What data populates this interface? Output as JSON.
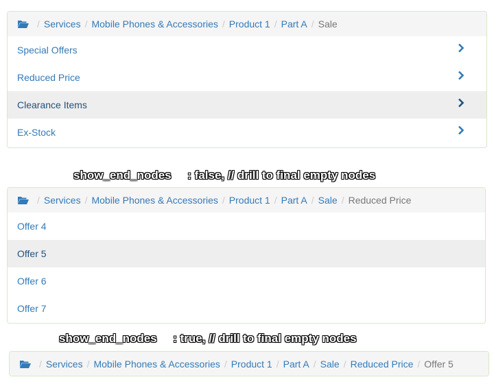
{
  "panel1": {
    "breadcrumb": [
      "Services",
      "Mobile Phones & Accessories",
      "Product 1",
      "Part A"
    ],
    "breadcrumb_active": "Sale",
    "items": [
      "Special Offers",
      "Reduced Price",
      "Clearance Items",
      "Ex-Stock"
    ],
    "highlighted_index": 2
  },
  "caption1": {
    "key": "show_end_nodes",
    "value": ": false, // drill to final empty nodes"
  },
  "panel2": {
    "breadcrumb": [
      "Services",
      "Mobile Phones & Accessories",
      "Product 1",
      "Part A",
      "Sale"
    ],
    "breadcrumb_active": "Reduced Price",
    "items": [
      "Offer 4",
      "Offer 5",
      "Offer 6",
      "Offer 7"
    ],
    "highlighted_index": 1
  },
  "caption2": {
    "key": "show_end_nodes",
    "value": ": true, // drill to final empty nodes"
  },
  "panel3": {
    "breadcrumb": [
      "Services",
      "Mobile Phones & Accessories",
      "Product 1",
      "Part A",
      "Sale",
      "Reduced Price"
    ],
    "breadcrumb_active": "Offer 5"
  },
  "colors": {
    "link": "#337ab7",
    "active_text": "#777777",
    "highlight_bg": "#eeeeee",
    "crumb_bg": "#f5f5f5",
    "border": "#d6e9c6"
  },
  "icons": {
    "home": "folder-open-icon",
    "row": "chevron-right-icon"
  }
}
